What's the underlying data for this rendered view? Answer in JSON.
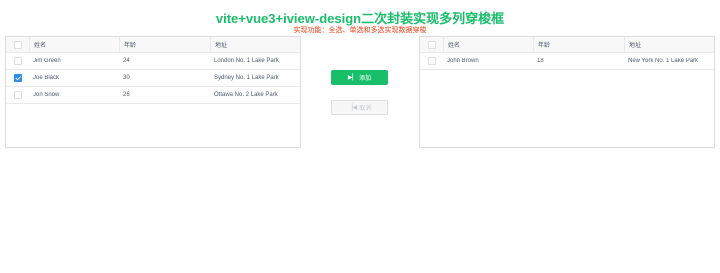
{
  "header": {
    "title": "vite+vue3+iview-design二次封装实现多列穿梭框",
    "subtitle": "实现功能：全选、单选和多选实现数据穿梭"
  },
  "columns": {
    "name": "姓名",
    "age": "年龄",
    "address": "地址"
  },
  "left_table": {
    "rows": [
      {
        "name": "Jim Green",
        "age": "24",
        "address": "London No. 1 Lake Park",
        "checked": false
      },
      {
        "name": "Joe Black",
        "age": "30",
        "address": "Sydney No. 1 Lake Park",
        "checked": true
      },
      {
        "name": "Jon Snow",
        "age": "26",
        "address": "Ottawa No. 2 Lake Park",
        "checked": false
      }
    ]
  },
  "right_table": {
    "rows": [
      {
        "name": "John Brown",
        "age": "18",
        "address": "New York No. 1 Lake Park",
        "checked": false
      }
    ]
  },
  "buttons": {
    "add_icon": "play-icon",
    "add_label": "添加",
    "cancel_icon": "back-icon",
    "cancel_label": "取消"
  },
  "colors": {
    "accent": "#19be6b",
    "subtitle": "#ed4014",
    "checkbox": "#2d8cf0"
  }
}
